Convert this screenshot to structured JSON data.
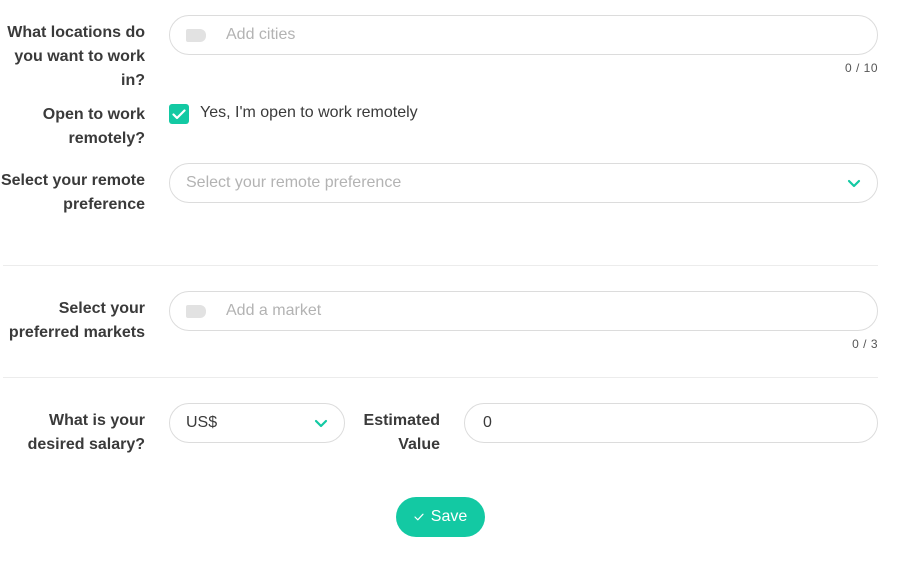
{
  "locations": {
    "label": "What locations do you want to work in?",
    "placeholder": "Add cities",
    "counter": "0 / 10"
  },
  "remote": {
    "label": "Open to work remotely?",
    "checkbox_label": "Yes, I'm open to work remotely",
    "checked": true
  },
  "remote_preference": {
    "label": "Select your remote preference",
    "placeholder": "Select your remote preference"
  },
  "markets": {
    "label": "Select your preferred markets",
    "placeholder": "Add a market",
    "counter": "0 / 3"
  },
  "salary": {
    "label": "What is your desired salary?",
    "currency": "US$",
    "estimated_label": "Estimated Value",
    "value": "0"
  },
  "save": {
    "label": "Save"
  },
  "colors": {
    "accent": "#13c9a3",
    "border": "#dcdcdc",
    "placeholder": "#b3b3b3"
  },
  "icons": {
    "tag": "tag-icon",
    "chevron": "chevron-down-icon",
    "check": "check-icon"
  }
}
